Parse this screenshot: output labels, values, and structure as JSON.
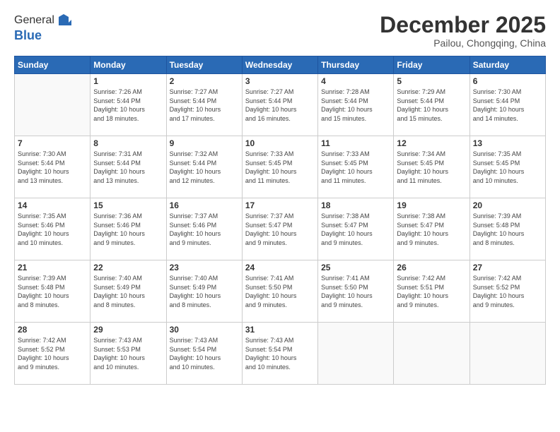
{
  "logo": {
    "general": "General",
    "blue": "Blue"
  },
  "title": "December 2025",
  "subtitle": "Pailou, Chongqing, China",
  "weekdays": [
    "Sunday",
    "Monday",
    "Tuesday",
    "Wednesday",
    "Thursday",
    "Friday",
    "Saturday"
  ],
  "weeks": [
    [
      {
        "day": "",
        "info": ""
      },
      {
        "day": "1",
        "info": "Sunrise: 7:26 AM\nSunset: 5:44 PM\nDaylight: 10 hours\nand 18 minutes."
      },
      {
        "day": "2",
        "info": "Sunrise: 7:27 AM\nSunset: 5:44 PM\nDaylight: 10 hours\nand 17 minutes."
      },
      {
        "day": "3",
        "info": "Sunrise: 7:27 AM\nSunset: 5:44 PM\nDaylight: 10 hours\nand 16 minutes."
      },
      {
        "day": "4",
        "info": "Sunrise: 7:28 AM\nSunset: 5:44 PM\nDaylight: 10 hours\nand 15 minutes."
      },
      {
        "day": "5",
        "info": "Sunrise: 7:29 AM\nSunset: 5:44 PM\nDaylight: 10 hours\nand 15 minutes."
      },
      {
        "day": "6",
        "info": "Sunrise: 7:30 AM\nSunset: 5:44 PM\nDaylight: 10 hours\nand 14 minutes."
      }
    ],
    [
      {
        "day": "7",
        "info": "Sunrise: 7:30 AM\nSunset: 5:44 PM\nDaylight: 10 hours\nand 13 minutes."
      },
      {
        "day": "8",
        "info": "Sunrise: 7:31 AM\nSunset: 5:44 PM\nDaylight: 10 hours\nand 13 minutes."
      },
      {
        "day": "9",
        "info": "Sunrise: 7:32 AM\nSunset: 5:44 PM\nDaylight: 10 hours\nand 12 minutes."
      },
      {
        "day": "10",
        "info": "Sunrise: 7:33 AM\nSunset: 5:45 PM\nDaylight: 10 hours\nand 11 minutes."
      },
      {
        "day": "11",
        "info": "Sunrise: 7:33 AM\nSunset: 5:45 PM\nDaylight: 10 hours\nand 11 minutes."
      },
      {
        "day": "12",
        "info": "Sunrise: 7:34 AM\nSunset: 5:45 PM\nDaylight: 10 hours\nand 11 minutes."
      },
      {
        "day": "13",
        "info": "Sunrise: 7:35 AM\nSunset: 5:45 PM\nDaylight: 10 hours\nand 10 minutes."
      }
    ],
    [
      {
        "day": "14",
        "info": "Sunrise: 7:35 AM\nSunset: 5:46 PM\nDaylight: 10 hours\nand 10 minutes."
      },
      {
        "day": "15",
        "info": "Sunrise: 7:36 AM\nSunset: 5:46 PM\nDaylight: 10 hours\nand 9 minutes."
      },
      {
        "day": "16",
        "info": "Sunrise: 7:37 AM\nSunset: 5:46 PM\nDaylight: 10 hours\nand 9 minutes."
      },
      {
        "day": "17",
        "info": "Sunrise: 7:37 AM\nSunset: 5:47 PM\nDaylight: 10 hours\nand 9 minutes."
      },
      {
        "day": "18",
        "info": "Sunrise: 7:38 AM\nSunset: 5:47 PM\nDaylight: 10 hours\nand 9 minutes."
      },
      {
        "day": "19",
        "info": "Sunrise: 7:38 AM\nSunset: 5:47 PM\nDaylight: 10 hours\nand 9 minutes."
      },
      {
        "day": "20",
        "info": "Sunrise: 7:39 AM\nSunset: 5:48 PM\nDaylight: 10 hours\nand 8 minutes."
      }
    ],
    [
      {
        "day": "21",
        "info": "Sunrise: 7:39 AM\nSunset: 5:48 PM\nDaylight: 10 hours\nand 8 minutes."
      },
      {
        "day": "22",
        "info": "Sunrise: 7:40 AM\nSunset: 5:49 PM\nDaylight: 10 hours\nand 8 minutes."
      },
      {
        "day": "23",
        "info": "Sunrise: 7:40 AM\nSunset: 5:49 PM\nDaylight: 10 hours\nand 8 minutes."
      },
      {
        "day": "24",
        "info": "Sunrise: 7:41 AM\nSunset: 5:50 PM\nDaylight: 10 hours\nand 9 minutes."
      },
      {
        "day": "25",
        "info": "Sunrise: 7:41 AM\nSunset: 5:50 PM\nDaylight: 10 hours\nand 9 minutes."
      },
      {
        "day": "26",
        "info": "Sunrise: 7:42 AM\nSunset: 5:51 PM\nDaylight: 10 hours\nand 9 minutes."
      },
      {
        "day": "27",
        "info": "Sunrise: 7:42 AM\nSunset: 5:52 PM\nDaylight: 10 hours\nand 9 minutes."
      }
    ],
    [
      {
        "day": "28",
        "info": "Sunrise: 7:42 AM\nSunset: 5:52 PM\nDaylight: 10 hours\nand 9 minutes."
      },
      {
        "day": "29",
        "info": "Sunrise: 7:43 AM\nSunset: 5:53 PM\nDaylight: 10 hours\nand 10 minutes."
      },
      {
        "day": "30",
        "info": "Sunrise: 7:43 AM\nSunset: 5:54 PM\nDaylight: 10 hours\nand 10 minutes."
      },
      {
        "day": "31",
        "info": "Sunrise: 7:43 AM\nSunset: 5:54 PM\nDaylight: 10 hours\nand 10 minutes."
      },
      {
        "day": "",
        "info": ""
      },
      {
        "day": "",
        "info": ""
      },
      {
        "day": "",
        "info": ""
      }
    ]
  ]
}
